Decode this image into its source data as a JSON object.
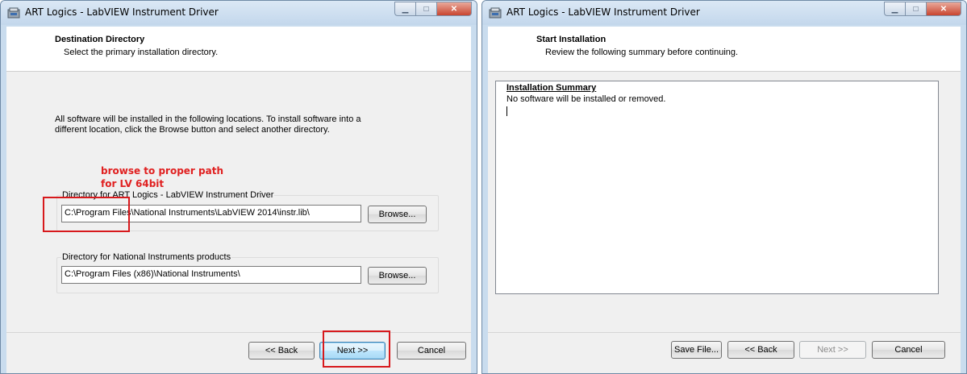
{
  "left_window": {
    "title": "ART Logics - LabVIEW Instrument Driver",
    "header_title": "Destination Directory",
    "header_subtitle": "Select the primary installation directory.",
    "intro_line1": "All software will be installed in the following locations. To install software into a",
    "intro_line2": "different location, click the Browse button and select another directory.",
    "annotation_line1": "browse to proper path",
    "annotation_line2": "for LV 64bit",
    "group1_label": "Directory for ART Logics - LabVIEW Instrument Driver",
    "group1_path": "C:\\Program Files\\National Instruments\\LabVIEW 2014\\instr.lib\\",
    "group2_label": "Directory for National Instruments products",
    "group2_path": "C:\\Program Files (x86)\\National Instruments\\",
    "browse_label": "Browse...",
    "back_label": "<< Back",
    "next_label": "Next >>",
    "cancel_label": "Cancel"
  },
  "right_window": {
    "title": "ART Logics - LabVIEW Instrument Driver",
    "header_title": "Start Installation",
    "header_subtitle": "Review the following summary before continuing.",
    "summary_title": "Installation Summary",
    "summary_text": "No software will be installed or removed.",
    "save_label": "Save File...",
    "back_label": "<< Back",
    "next_label": "Next >>",
    "cancel_label": "Cancel"
  },
  "window_controls": {
    "minimize_glyph": "▁",
    "maximize_glyph": "□",
    "close_glyph": "✕"
  },
  "colors": {
    "annotation_red": "#e02020",
    "title_bar": "#c9dcee"
  }
}
